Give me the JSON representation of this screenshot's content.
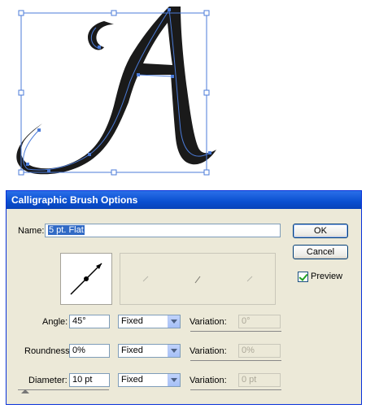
{
  "dialog": {
    "title": "Calligraphic Brush Options",
    "name_label": "Name:",
    "name_value": "5 pt. Flat",
    "ok_label": "OK",
    "cancel_label": "Cancel",
    "preview_label": "Preview",
    "preview_checked": true,
    "rows": [
      {
        "label": "Angle:",
        "value": "45°",
        "mode": "Fixed",
        "variation_label": "Variation:",
        "variation_value": "0°"
      },
      {
        "label": "Roundness:",
        "value": "0%",
        "mode": "Fixed",
        "variation_label": "Variation:",
        "variation_value": "0%"
      },
      {
        "label": "Diameter:",
        "value": "10 pt",
        "mode": "Fixed",
        "variation_label": "Variation:",
        "variation_value": "0 pt"
      }
    ]
  },
  "colors": {
    "title_bar": "#0a4fd0",
    "dialog_bg": "#ece9d8",
    "selection": "#316ac5",
    "path_blue": "#4b7bd8",
    "letter_fill": "#1a1a1a"
  }
}
